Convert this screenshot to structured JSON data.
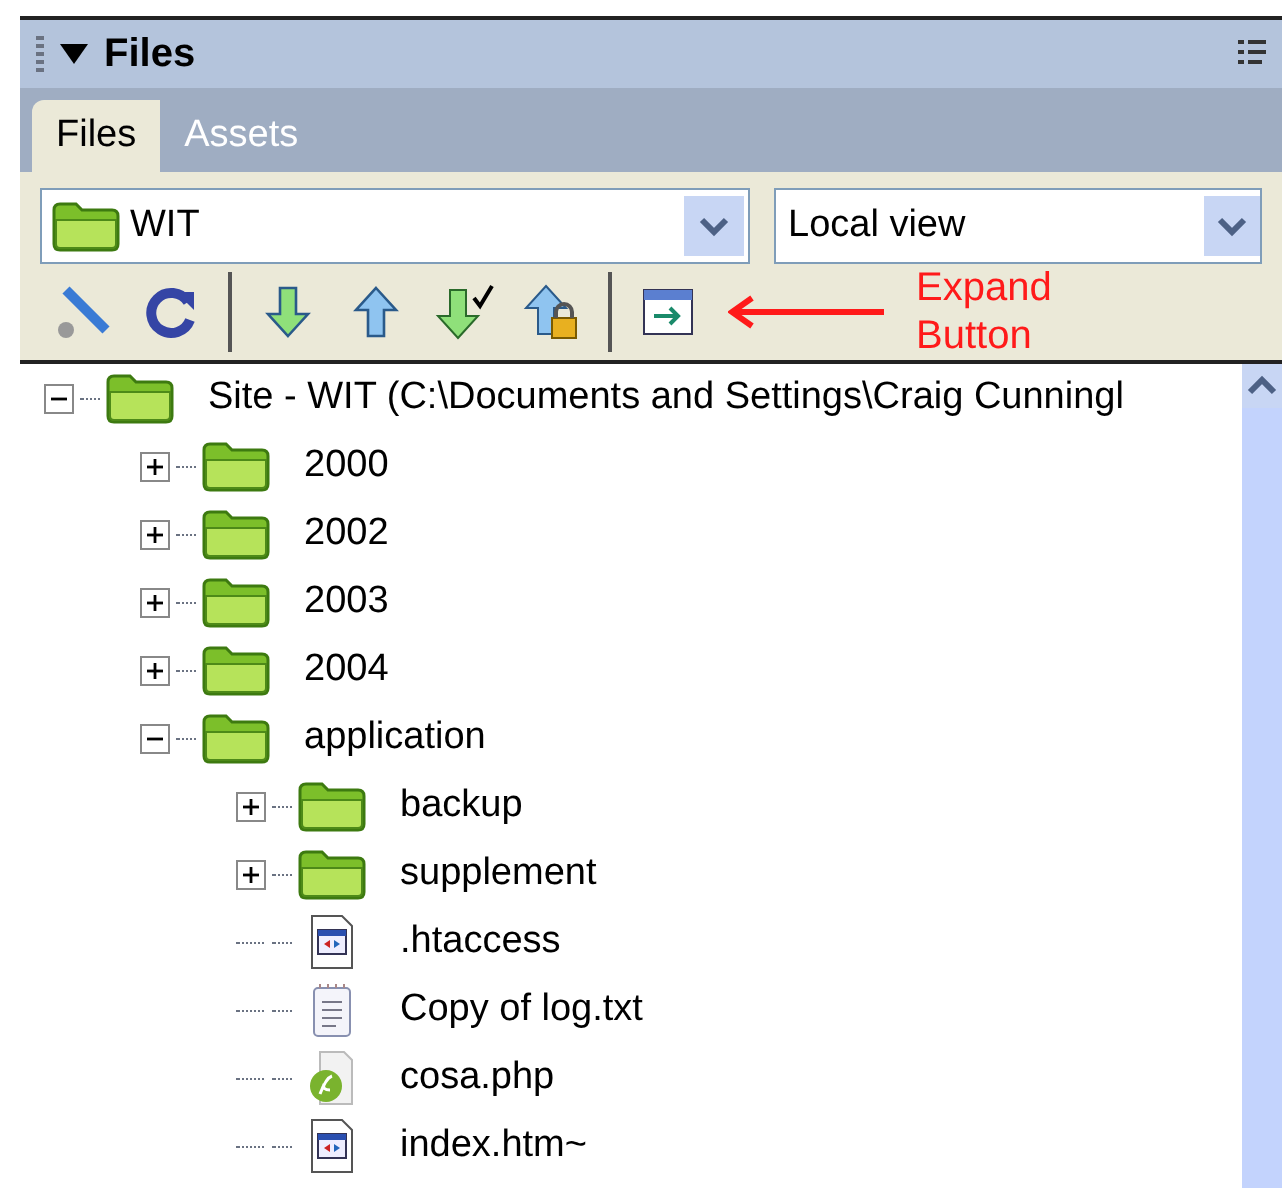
{
  "panel": {
    "title": "Files",
    "collapsed": false
  },
  "tabs": [
    {
      "label": "Files",
      "selected": true
    },
    {
      "label": "Assets",
      "selected": false
    }
  ],
  "site_select": {
    "value": "WIT"
  },
  "view_select": {
    "value": "Local view"
  },
  "annotation": {
    "text": "Expand Button"
  },
  "tree": [
    {
      "kind": "folder",
      "label": "Site - WIT (C:\\Documents and Settings\\Craig Cunningl",
      "expanded": true,
      "children": [
        {
          "kind": "folder",
          "label": "2000",
          "expanded": false
        },
        {
          "kind": "folder",
          "label": "2002",
          "expanded": false
        },
        {
          "kind": "folder",
          "label": "2003",
          "expanded": false
        },
        {
          "kind": "folder",
          "label": "2004",
          "expanded": false
        },
        {
          "kind": "folder",
          "label": "application",
          "expanded": true,
          "children": [
            {
              "kind": "folder",
              "label": "backup",
              "expanded": false
            },
            {
              "kind": "folder",
              "label": "supplement",
              "expanded": false
            },
            {
              "kind": "web",
              "label": ".htaccess"
            },
            {
              "kind": "text",
              "label": "Copy of log.txt"
            },
            {
              "kind": "script",
              "label": "cosa.php"
            },
            {
              "kind": "web",
              "label": "index.htm~"
            }
          ]
        }
      ]
    }
  ]
}
